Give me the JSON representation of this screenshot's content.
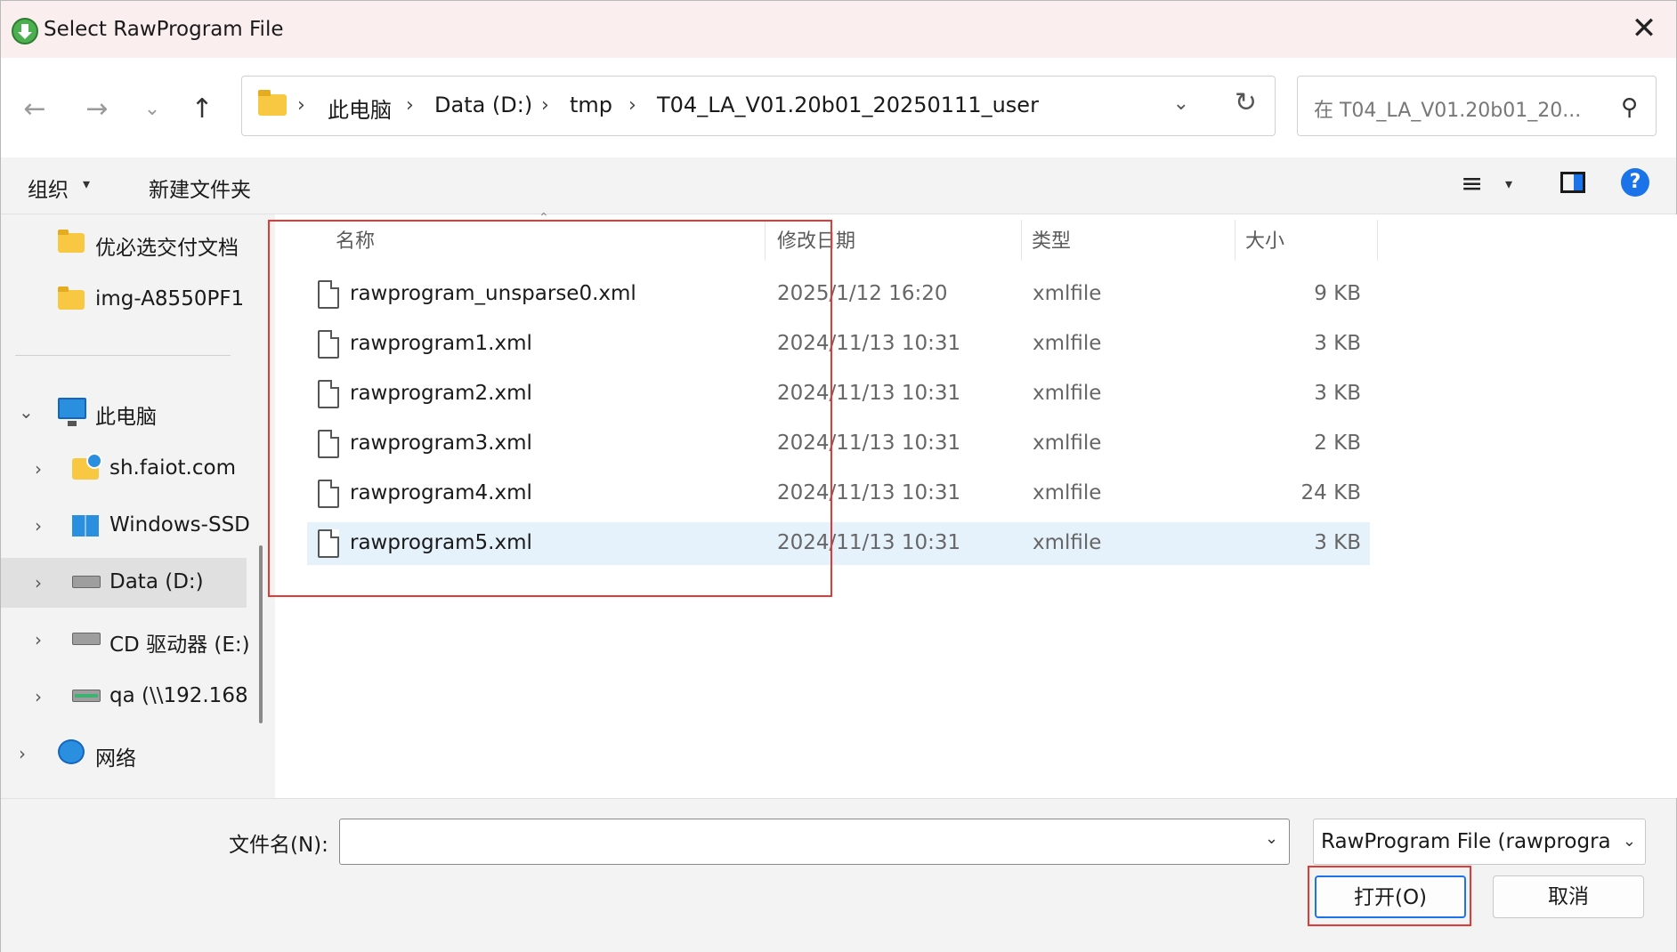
{
  "window": {
    "title": "Select RawProgram File",
    "close_glyph": "✕"
  },
  "nav": {
    "back_glyph": "←",
    "forward_glyph": "→",
    "recent_glyph": "⌄",
    "up_glyph": "↑",
    "breadcrumb": [
      "此电脑",
      "Data (D:)",
      "tmp",
      "T04_LA_V01.20b01_20250111_user"
    ],
    "separator": "›",
    "dropdown_glyph": "⌄",
    "refresh_glyph": "↻",
    "search_placeholder": "在 T04_LA_V01.20b01_20...",
    "search_glyph": "⚲"
  },
  "toolbar": {
    "organize": "组织",
    "caret": "▾",
    "new_folder": "新建文件夹",
    "view_glyph": "≡",
    "help_glyph": "?"
  },
  "sidebar": {
    "items": [
      {
        "label": "优必选交付文档",
        "icon": "folder-icon"
      },
      {
        "label": "img-A8550PF1",
        "icon": "folder-icon"
      },
      {
        "label": "此电脑",
        "icon": "computer-icon",
        "chevron": "⌄"
      },
      {
        "label": "sh.faiot.com",
        "icon": "network-drive-icon",
        "chevron": "›"
      },
      {
        "label": "Windows-SSD",
        "icon": "windows-drive-icon",
        "chevron": "›"
      },
      {
        "label": "Data (D:)",
        "icon": "drive-icon",
        "chevron": "›",
        "selected": true
      },
      {
        "label": "CD 驱动器 (E:)",
        "icon": "cd-drive-icon",
        "chevron": "›"
      },
      {
        "label": "qa (\\\\192.168",
        "icon": "network-share-icon",
        "chevron": "›"
      },
      {
        "label": "网络",
        "icon": "network-icon",
        "chevron": "›"
      }
    ]
  },
  "filelist": {
    "columns": {
      "name": "名称",
      "date": "修改日期",
      "type": "类型",
      "size": "大小"
    },
    "sort_glyph": "⌃",
    "rows": [
      {
        "name": "rawprogram_unsparse0.xml",
        "date": "2025/1/12 16:20",
        "type": "xmlfile",
        "size": "9 KB"
      },
      {
        "name": "rawprogram1.xml",
        "date": "2024/11/13 10:31",
        "type": "xmlfile",
        "size": "3 KB"
      },
      {
        "name": "rawprogram2.xml",
        "date": "2024/11/13 10:31",
        "type": "xmlfile",
        "size": "3 KB"
      },
      {
        "name": "rawprogram3.xml",
        "date": "2024/11/13 10:31",
        "type": "xmlfile",
        "size": "2 KB"
      },
      {
        "name": "rawprogram4.xml",
        "date": "2024/11/13 10:31",
        "type": "xmlfile",
        "size": "24 KB"
      },
      {
        "name": "rawprogram5.xml",
        "date": "2024/11/13 10:31",
        "type": "xmlfile",
        "size": "3 KB"
      }
    ]
  },
  "bottom": {
    "filename_label": "文件名(N):",
    "filename_value": "",
    "filter": "RawProgram File (rawprogram*.xml)",
    "caret": "⌄",
    "open_button": "打开(O)",
    "cancel_button": "取消"
  },
  "colors": {
    "highlight": "#e53935",
    "selection": "#e5f1fb",
    "accent": "#1a73e8"
  }
}
